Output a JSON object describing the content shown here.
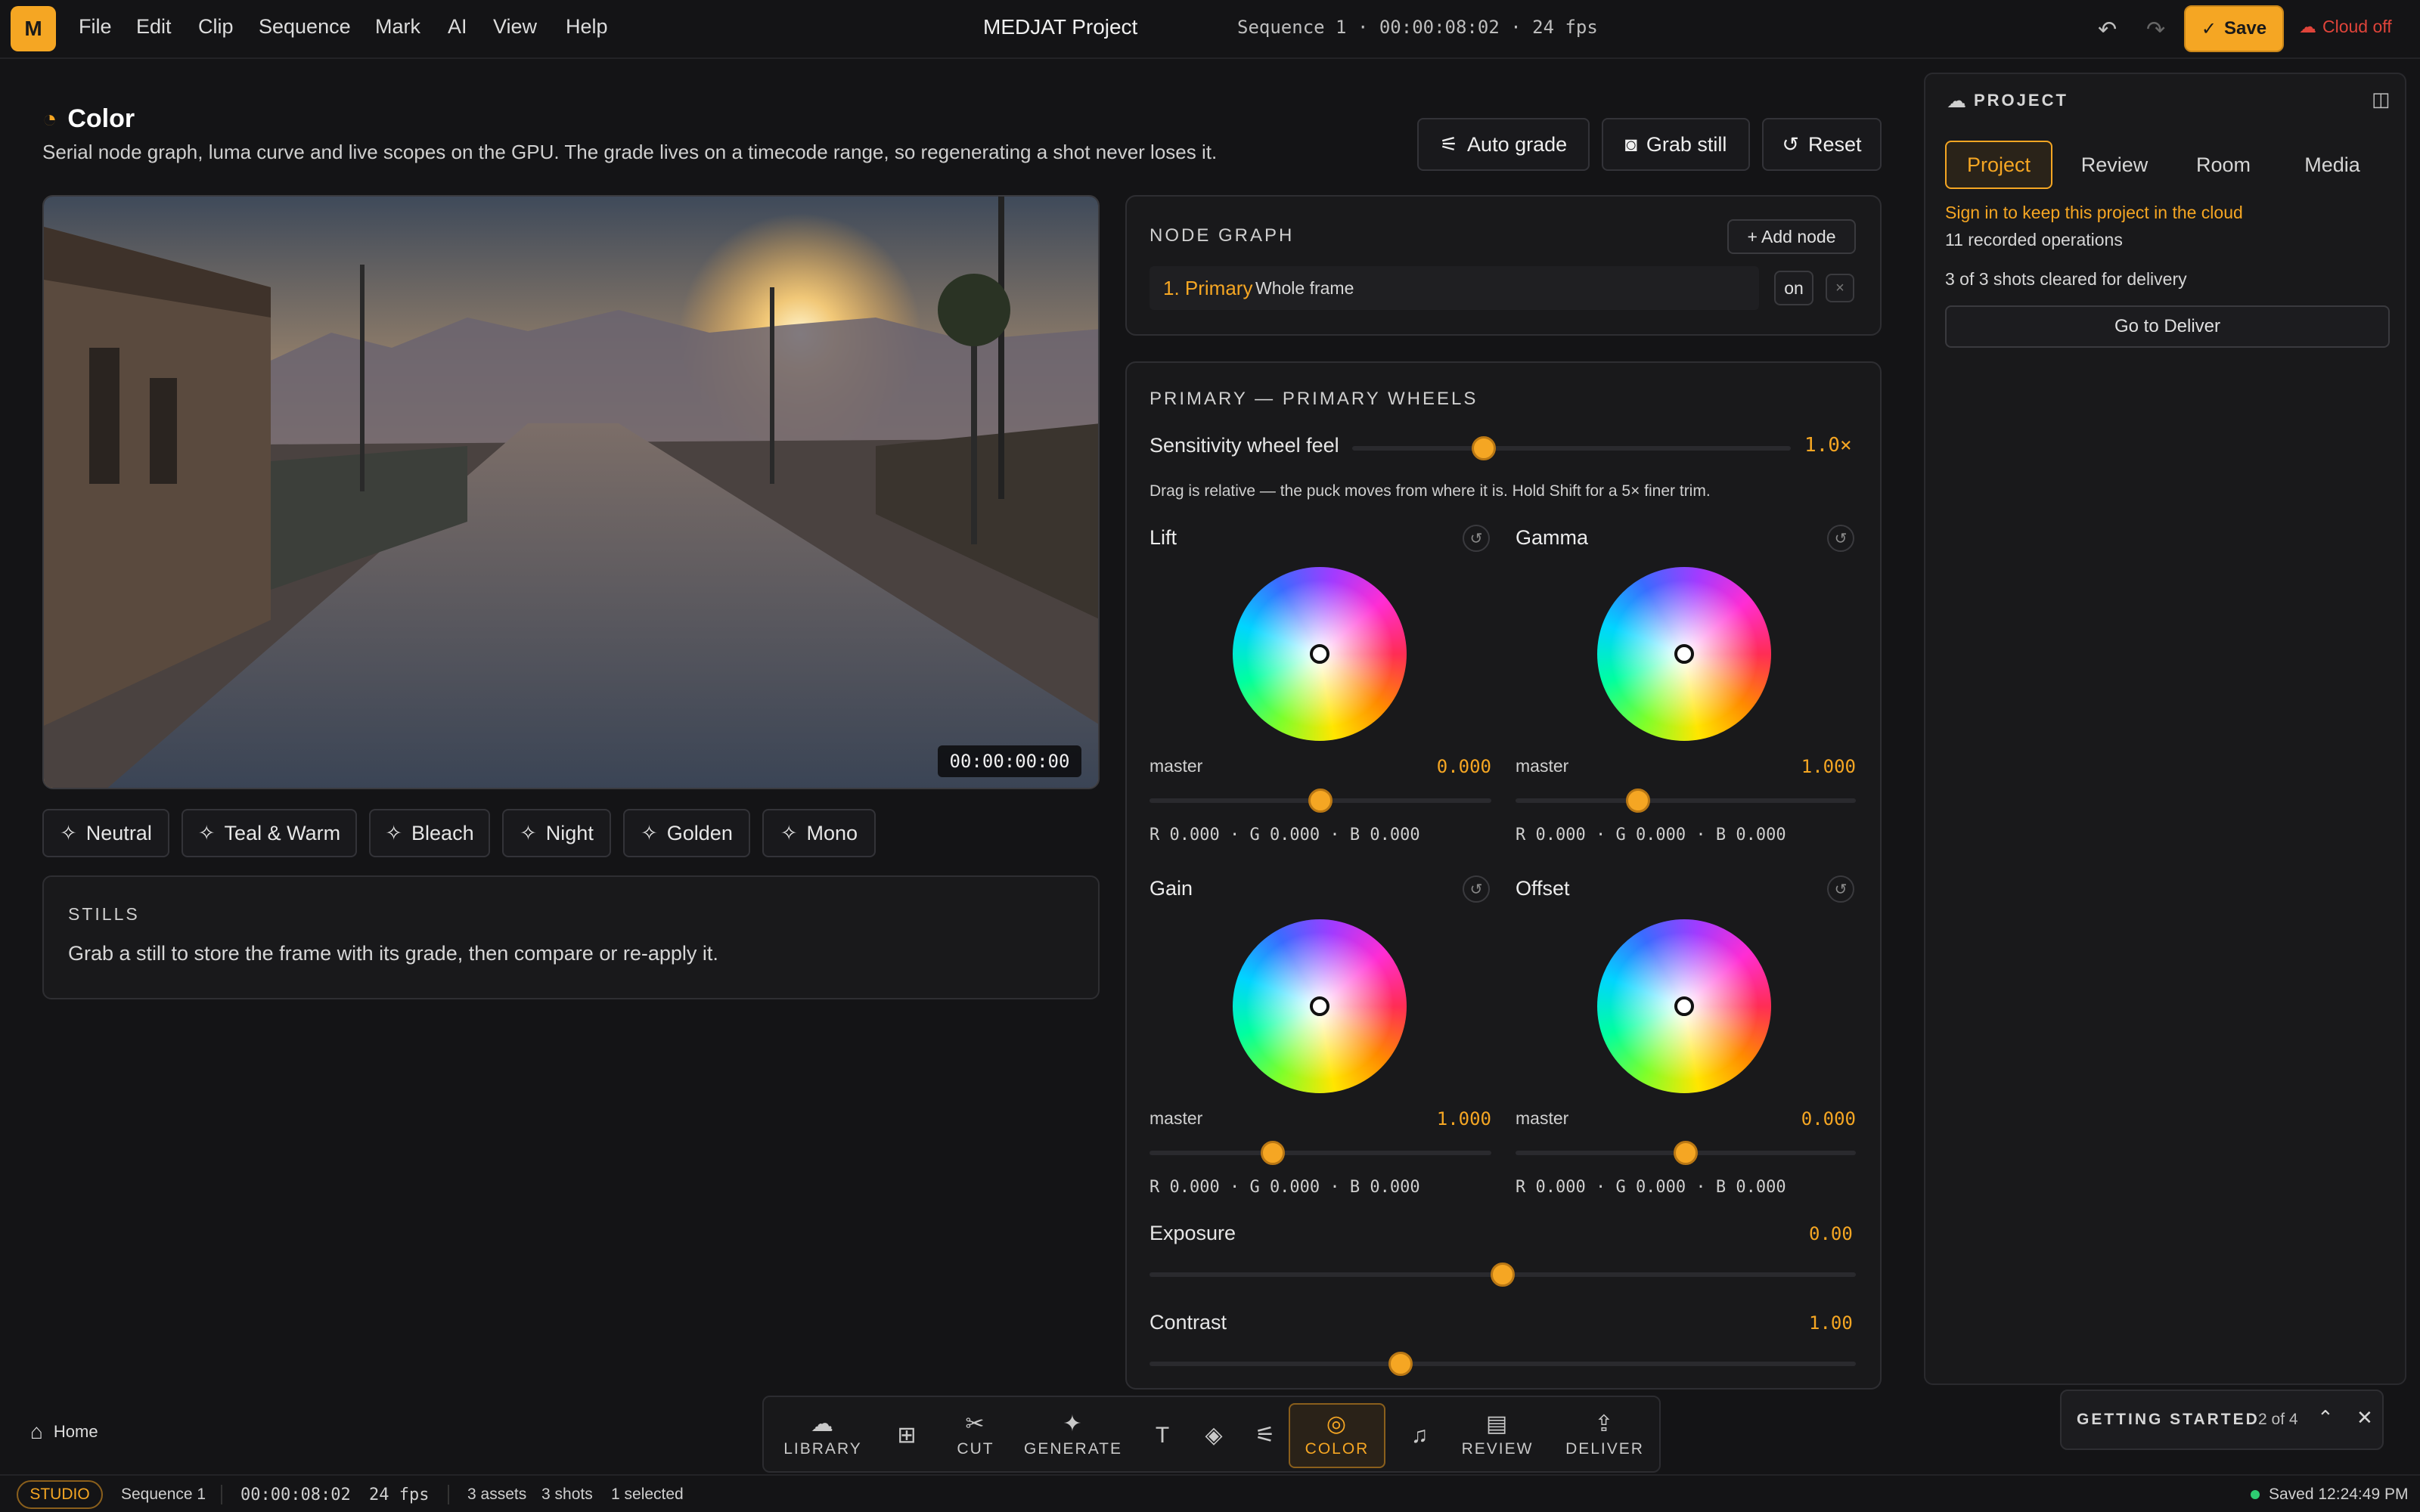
{
  "app": {
    "logo": "M",
    "title": "MEDJAT Project",
    "sequence_info": "Sequence 1 · 00:00:08:02 · 24 fps",
    "save_label": "Save",
    "cloud_status": "Cloud off"
  },
  "menu": [
    "File",
    "Edit",
    "Clip",
    "Sequence",
    "Mark",
    "AI",
    "View",
    "Help"
  ],
  "section": {
    "title": "Color",
    "description": "Serial node graph, luma curve and live scopes on the GPU. The grade lives on a timecode range, so regenerating a shot never loses it.",
    "buttons": {
      "auto_grade": "Auto grade",
      "grab_still": "Grab still",
      "reset": "Reset"
    }
  },
  "viewer": {
    "timecode": "00:00:00:00"
  },
  "presets": [
    "Neutral",
    "Teal & Warm",
    "Bleach",
    "Night",
    "Golden",
    "Mono"
  ],
  "stills": {
    "title": "STILLS",
    "description": "Grab a still to store the frame with its grade, then compare or re-apply it."
  },
  "node_graph": {
    "title": "NODE GRAPH",
    "add_label": "+ Add node",
    "node_name": "1. Primary",
    "node_scope": "Whole frame",
    "toggle_label": "on",
    "remove_label": "×"
  },
  "primary": {
    "title": "PRIMARY — PRIMARY WHEELS",
    "sensitivity_label": "Sensitivity wheel feel",
    "sensitivity_value": "1.0×",
    "sensitivity_fraction": 0.3,
    "hint": "Drag is relative — the puck moves from where it is. Hold Shift for a 5× finer trim.",
    "wheels": [
      {
        "name": "Lift",
        "master_label": "master",
        "master_value": "0.000",
        "master_fraction": 0.5,
        "rgb": "R 0.000 · G 0.000 · B 0.000"
      },
      {
        "name": "Gamma",
        "master_label": "master",
        "master_value": "1.000",
        "master_fraction": 0.36,
        "rgb": "R 0.000 · G 0.000 · B 0.000"
      },
      {
        "name": "Gain",
        "master_label": "master",
        "master_value": "1.000",
        "master_fraction": 0.36,
        "rgb": "R 0.000 · G 0.000 · B 0.000"
      },
      {
        "name": "Offset",
        "master_label": "master",
        "master_value": "0.000",
        "master_fraction": 0.5,
        "rgb": "R 0.000 · G 0.000 · B 0.000"
      }
    ],
    "exposure_label": "Exposure",
    "exposure_value": "0.00",
    "exposure_fraction": 0.5,
    "contrast_label": "Contrast",
    "contrast_value": "1.00",
    "contrast_fraction": 0.355
  },
  "right_panel": {
    "title": "PROJECT",
    "tabs": [
      "Project",
      "Review",
      "Room",
      "Media"
    ],
    "sign_in": "Sign in to keep this project in the cloud",
    "operations": "11 recorded operations",
    "shots_cleared": "3 of 3 shots cleared for delivery",
    "deliver_button": "Go to Deliver"
  },
  "dock": {
    "library": "LIBRARY",
    "cut": "CUT",
    "generate": "GENERATE",
    "color": "COLOR",
    "review": "REVIEW",
    "deliver": "DELIVER"
  },
  "home_label": "Home",
  "getting_started": {
    "title": "GETTING STARTED",
    "progress": "2 of 4"
  },
  "status_bar": {
    "mode": "STUDIO",
    "sequence": "Sequence 1",
    "timecode": "00:00:08:02",
    "fps": "24 fps",
    "assets": "3 assets",
    "shots": "3 shots",
    "selected": "1 selected",
    "saved": "Saved 12:24:49 PM"
  },
  "colors": {
    "accent": "#f5a623",
    "danger": "#e0443a",
    "online": "#2ecc71"
  }
}
